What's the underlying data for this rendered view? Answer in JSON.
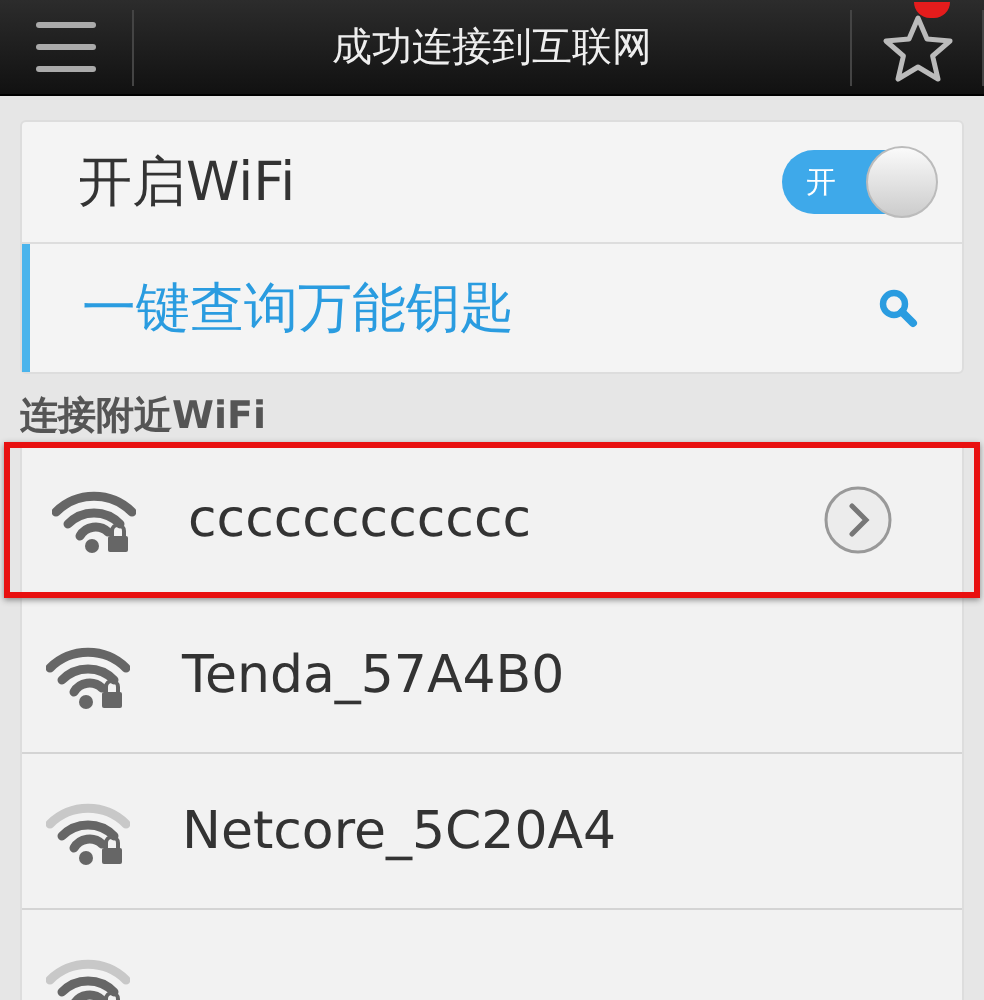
{
  "header": {
    "title": "成功连接到互联网",
    "unread": true
  },
  "wifi_toggle": {
    "label": "开启WiFi",
    "on": true,
    "switch_text": "开"
  },
  "key_search": {
    "label": "一键查询万能钥匙"
  },
  "section_title": "连接附近WiFi",
  "networks": [
    {
      "name": "cccccccccccc",
      "full_signal": true,
      "selected": true
    },
    {
      "name": "Tenda_57A4B0",
      "full_signal": true,
      "selected": false
    },
    {
      "name": "Netcore_5C20A4",
      "full_signal": false,
      "selected": false
    },
    {
      "full_signal": false,
      "selected": false
    }
  ]
}
